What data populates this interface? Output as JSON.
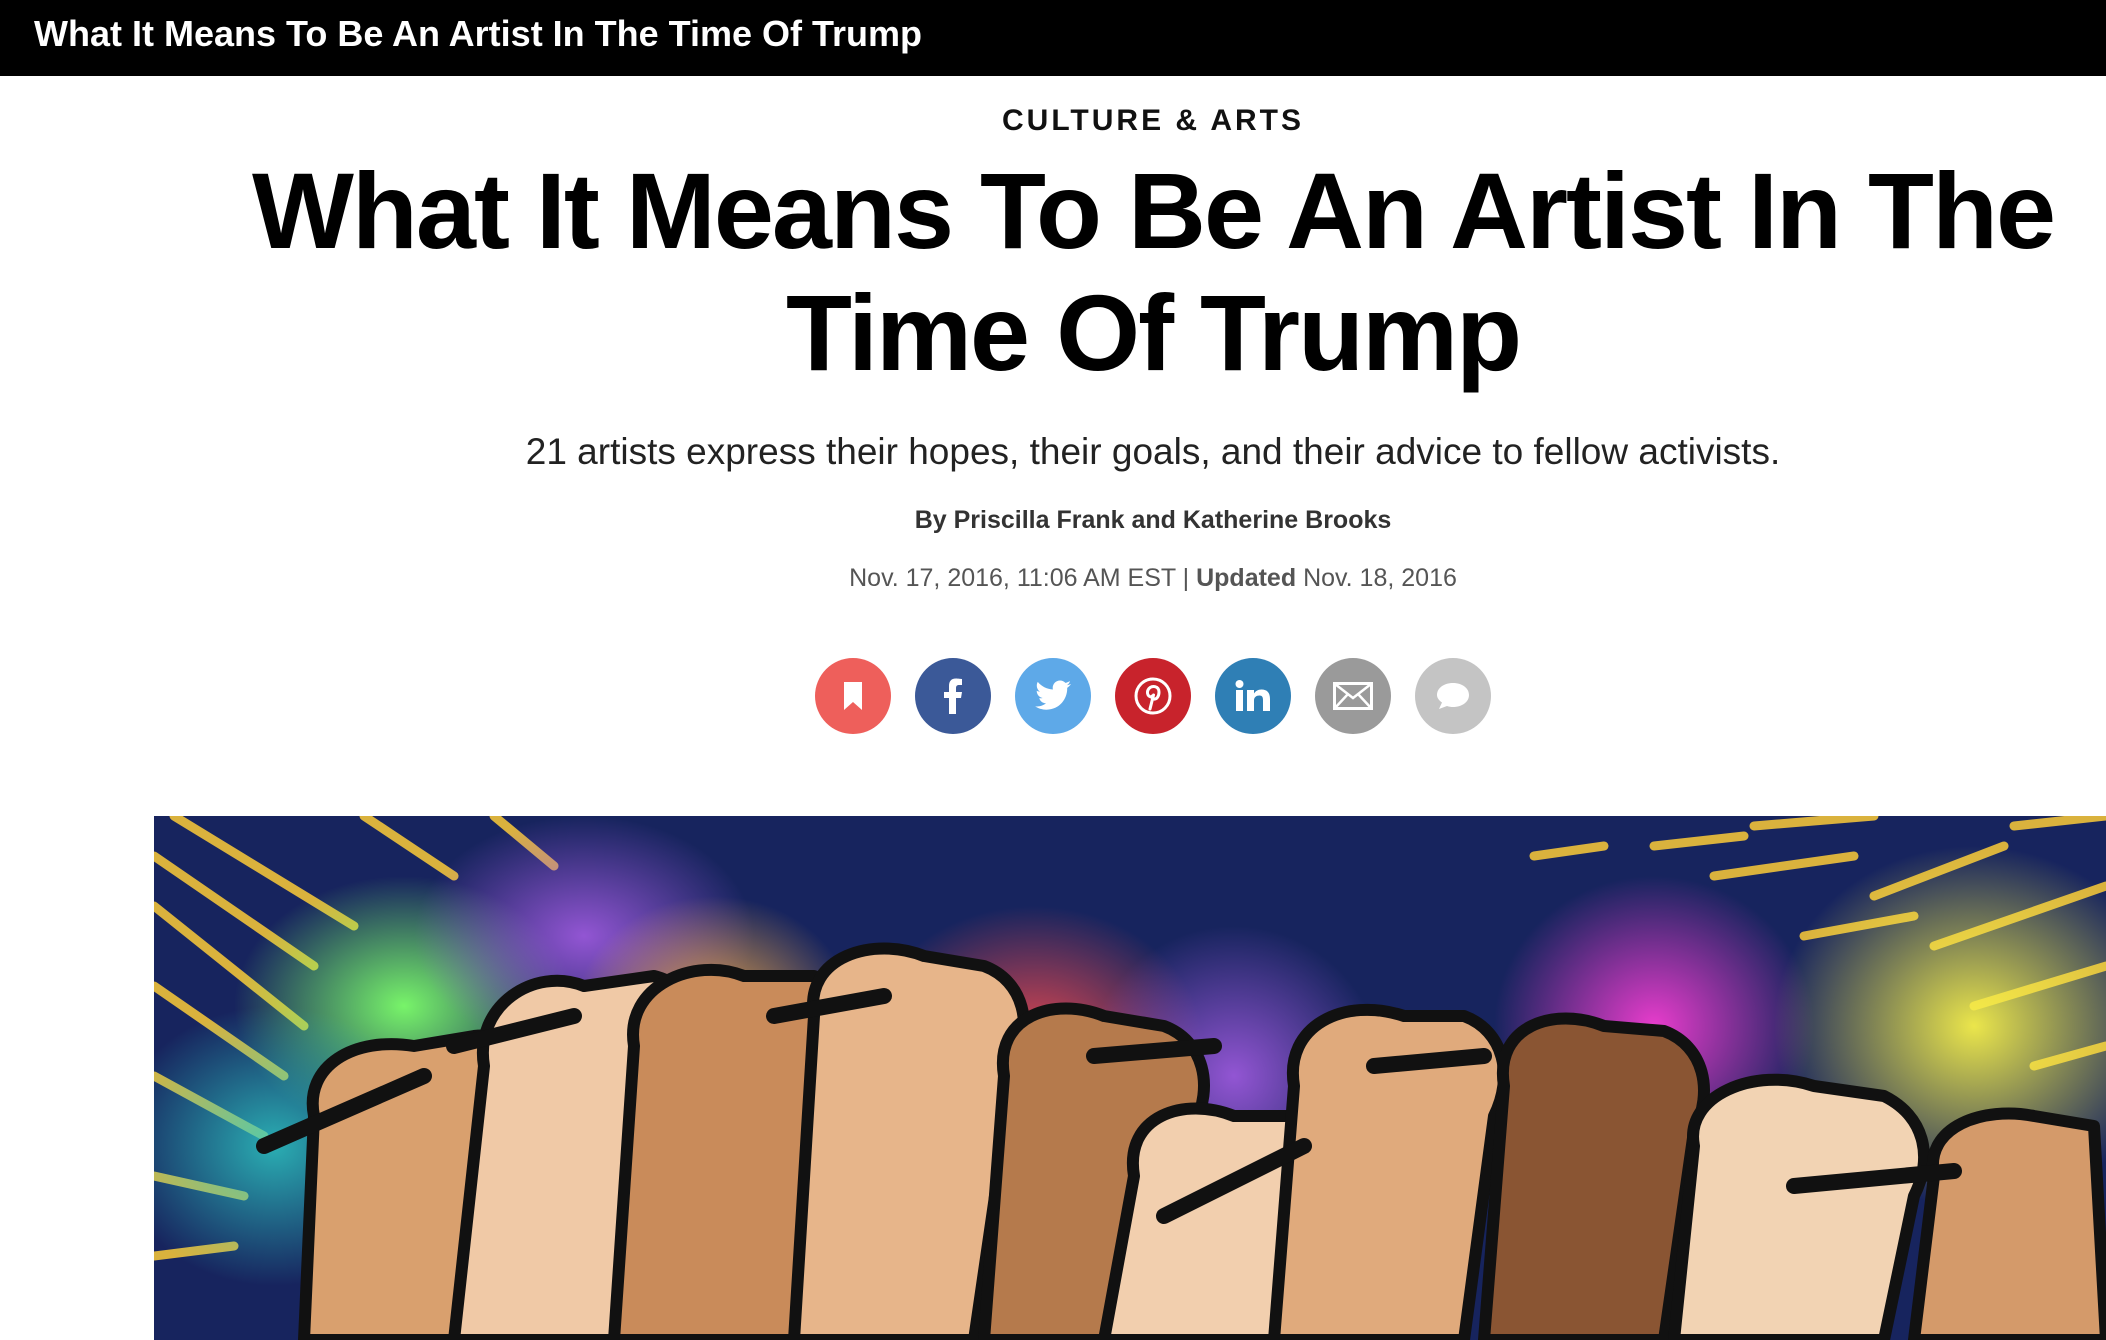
{
  "topbar": {
    "title": "What It Means To Be An Artist In The Time Of Trump"
  },
  "article": {
    "section": "CULTURE & ARTS",
    "headline": "What It Means To Be An Artist In The Time Of Trump",
    "dek": "21 artists express their hopes, their goals, and their advice to fellow activists.",
    "byline": "By Priscilla Frank and Katherine Brooks",
    "published": "Nov. 17, 2016, 11:06 AM EST |",
    "updated_label": "Updated",
    "updated_date": "Nov. 18, 2016"
  },
  "share": [
    {
      "name": "bookmark",
      "icon": "bookmark-icon",
      "color": "#ee5f5b"
    },
    {
      "name": "facebook",
      "icon": "facebook-icon",
      "color": "#3b5998"
    },
    {
      "name": "twitter",
      "icon": "twitter-icon",
      "color": "#5ea9e8"
    },
    {
      "name": "pinterest",
      "icon": "pinterest-icon",
      "color": "#c8232c"
    },
    {
      "name": "linkedin",
      "icon": "linkedin-icon",
      "color": "#2f7fb5"
    },
    {
      "name": "email",
      "icon": "mail-icon",
      "color": "#9a9a9a"
    },
    {
      "name": "comments",
      "icon": "comment-icon",
      "color": "#c4c4c4"
    }
  ]
}
